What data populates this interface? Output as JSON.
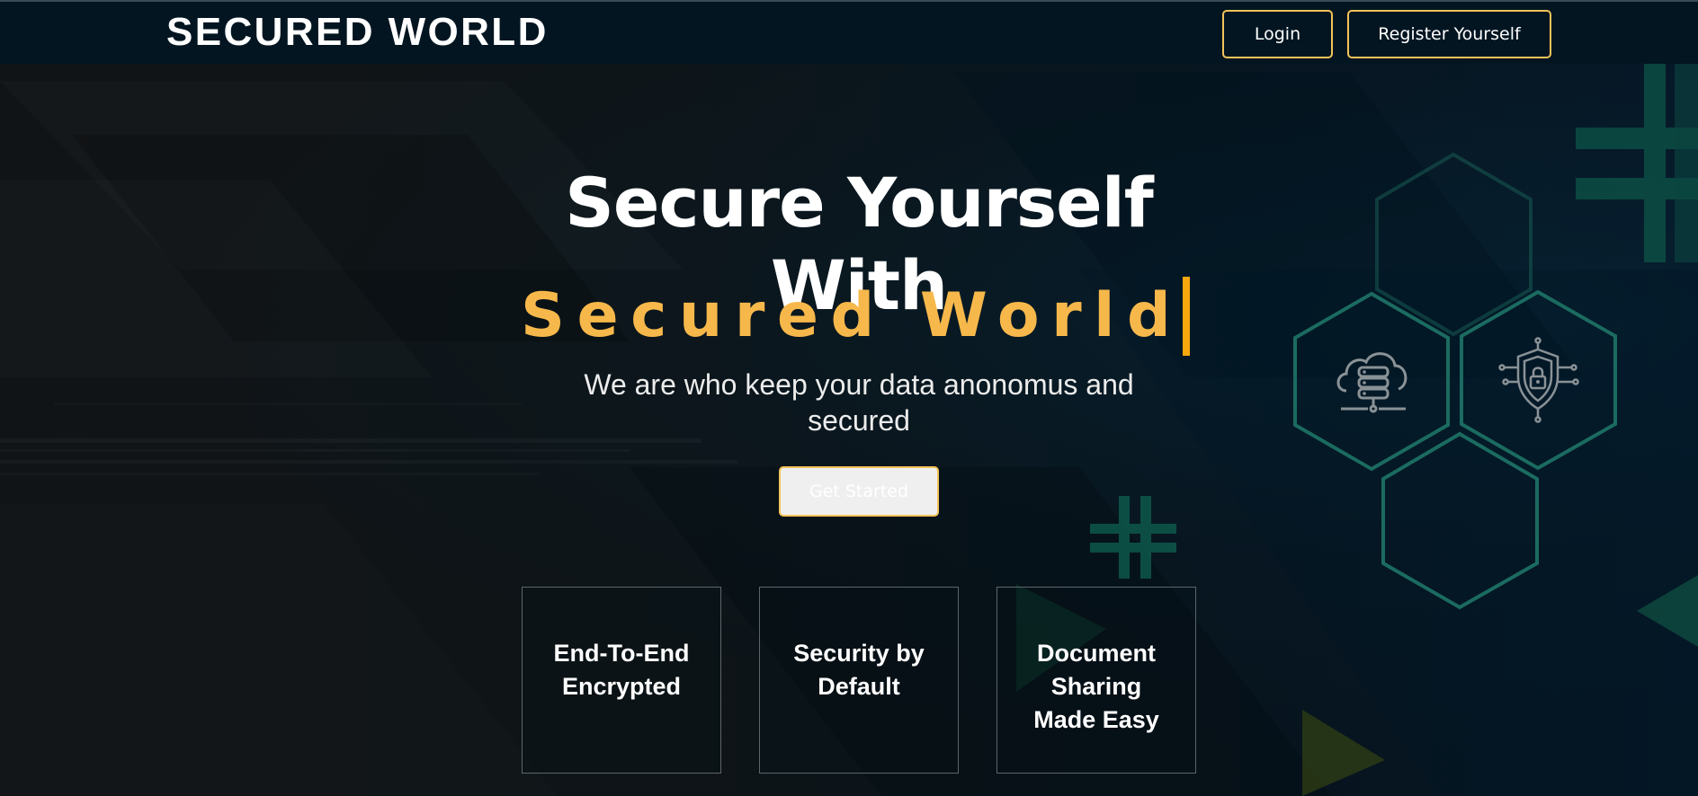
{
  "brand": {
    "name": "SECURED WORLD"
  },
  "nav": {
    "login_label": "Login",
    "register_label": "Register Yourself"
  },
  "hero": {
    "line1": "Secure Yourself",
    "line2": "With",
    "accent": "Secured World",
    "subtitle": "We are who keep your data anonomus and secured",
    "cta_label": "Get Started"
  },
  "features": [
    {
      "title": "End-To-End Encrypted"
    },
    {
      "title": "Security by Default"
    },
    {
      "title": "Document Sharing Made Easy"
    }
  ],
  "decorations": {
    "icons": [
      "cloud-server-icon",
      "shield-lock-icon",
      "plus-cross-icon"
    ]
  },
  "colors": {
    "accent": "#f7b84b",
    "button_border": "#f3c45a",
    "navbar_bg": "#021521",
    "hex_outline": "#1a5b52"
  }
}
